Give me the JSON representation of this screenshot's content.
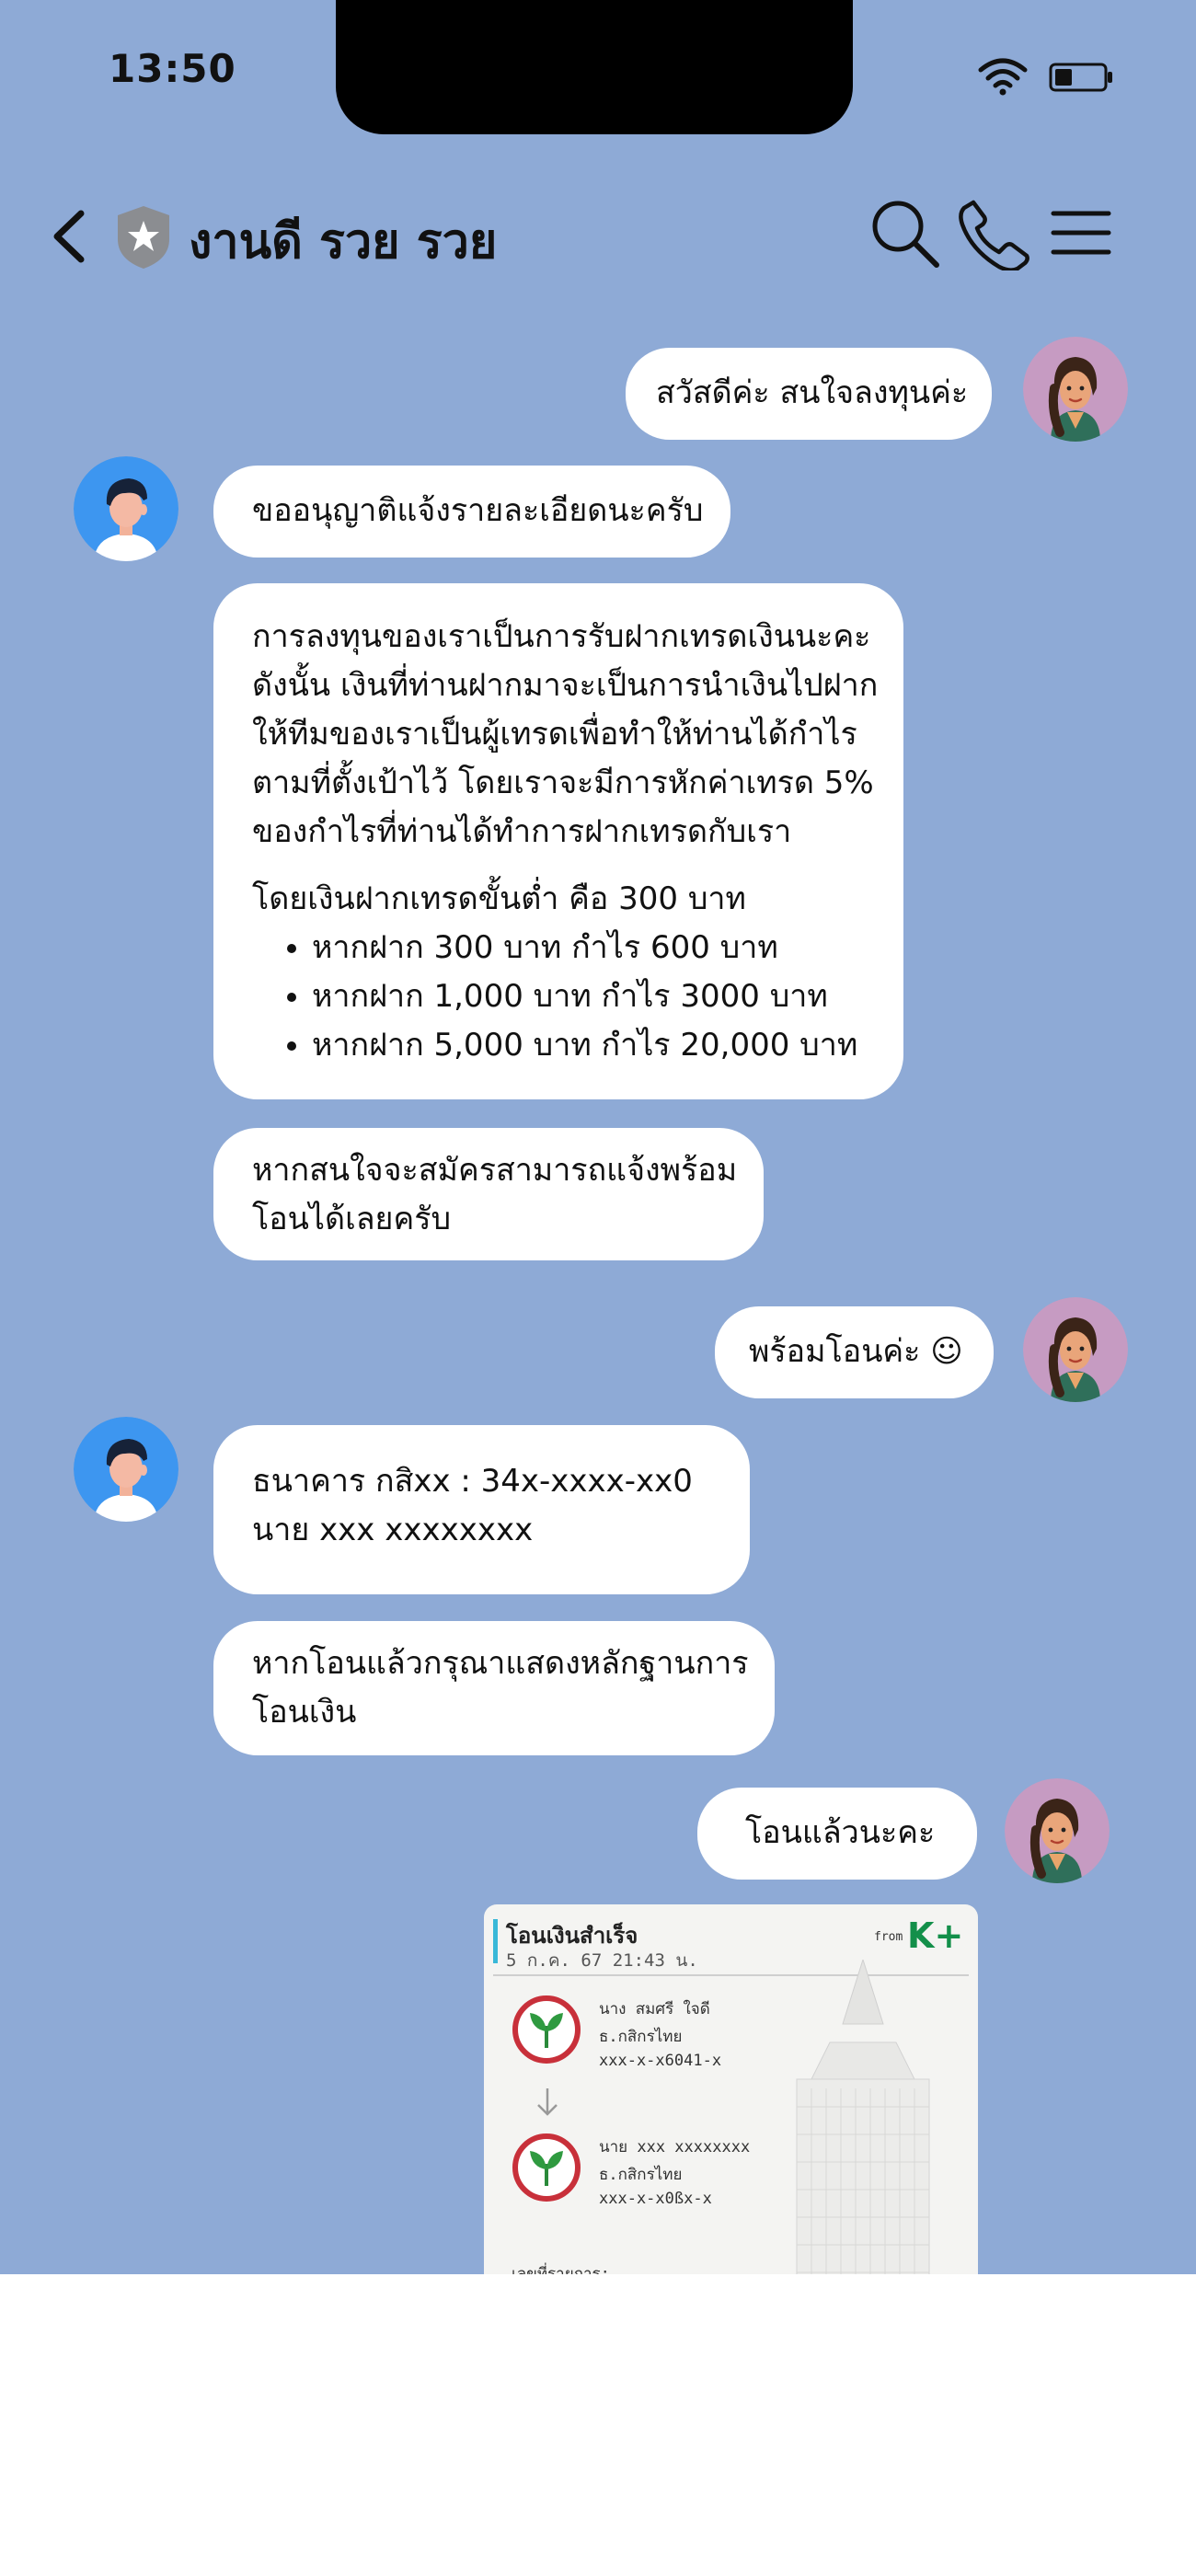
{
  "status_bar": {
    "time": "13:50"
  },
  "header": {
    "title": "งานดี รวย รวย"
  },
  "messages": [
    {
      "text": "สวัสดีค่ะ สนใจลงทุนค่ะ"
    },
    {
      "text": "ขออนุญาติแจ้งรายละเอียดนะครับ"
    },
    {
      "lines": [
        "การลงทุนของเราเป็นการรับฝากเทรดเงินนะคะ",
        "ดังนั้น เงินที่ท่านฝากมาจะเป็นการนำเงินไปฝาก",
        "ให้ทีมของเราเป็นผู้เทรดเพื่อทำให้ท่านได้กำไร",
        "ตามที่ตั้งเป้าไว้ โดยเราจะมีการหักค่าเทรด 5%",
        "ของกำไรที่ท่านได้ทำการฝากเทรดกับเรา"
      ],
      "min_deposit": "โดยเงินฝากเทรดขั้นต่ำ คือ 300 บาท",
      "bullets": [
        "หากฝาก 300 บาท กำไร 600 บาท",
        "หากฝาก 1,000 บาท กำไร 3000 บาท",
        "หากฝาก 5,000 บาท กำไร 20,000 บาท"
      ]
    },
    {
      "lines": [
        "หากสนใจจะสมัครสามารถแจ้งพร้อม",
        "โอนได้เลยครับ"
      ]
    },
    {
      "text": "พร้อมโอนค่ะ ☺"
    },
    {
      "lines": [
        "ธนาคาร กสิxx : 34x-xxxx-xx0",
        "นาย xxx xxxxxxxx"
      ]
    },
    {
      "lines": [
        "หากโอนแล้วกรุณาแสดงหลักฐานการ",
        "โอนเงิน"
      ]
    },
    {
      "text": "โอนแล้วนะคะ"
    }
  ],
  "receipt": {
    "title": "โอนเงินสำเร็จ",
    "date": "5 ก.ค. 67 21:43 น.",
    "logo": "K+",
    "logo_small": "from",
    "from_name": "นาง สมศรี ใจดี",
    "from_bank": "ธ.กสิกรไทย",
    "from_acct": "xxx-x-x6041-x",
    "to_name": "นาย xxx xxxxxxxx",
    "to_bank": "ธ.กสิกรไทย",
    "to_acct": "xxx-x-x0ßx-x",
    "footer": "เลขที่รายการ:"
  },
  "icons": {
    "back": "chevron-left-icon",
    "shield": "shield-star-icon",
    "search": "search-icon",
    "call": "phone-icon",
    "menu": "menu-icon",
    "wifi": "wifi-icon",
    "battery": "battery-icon"
  },
  "colors": {
    "background": "#8eaad6",
    "bubble": "#ffffff",
    "male_avatar": "#3d96f0",
    "female_avatar": "#c69bc2"
  }
}
